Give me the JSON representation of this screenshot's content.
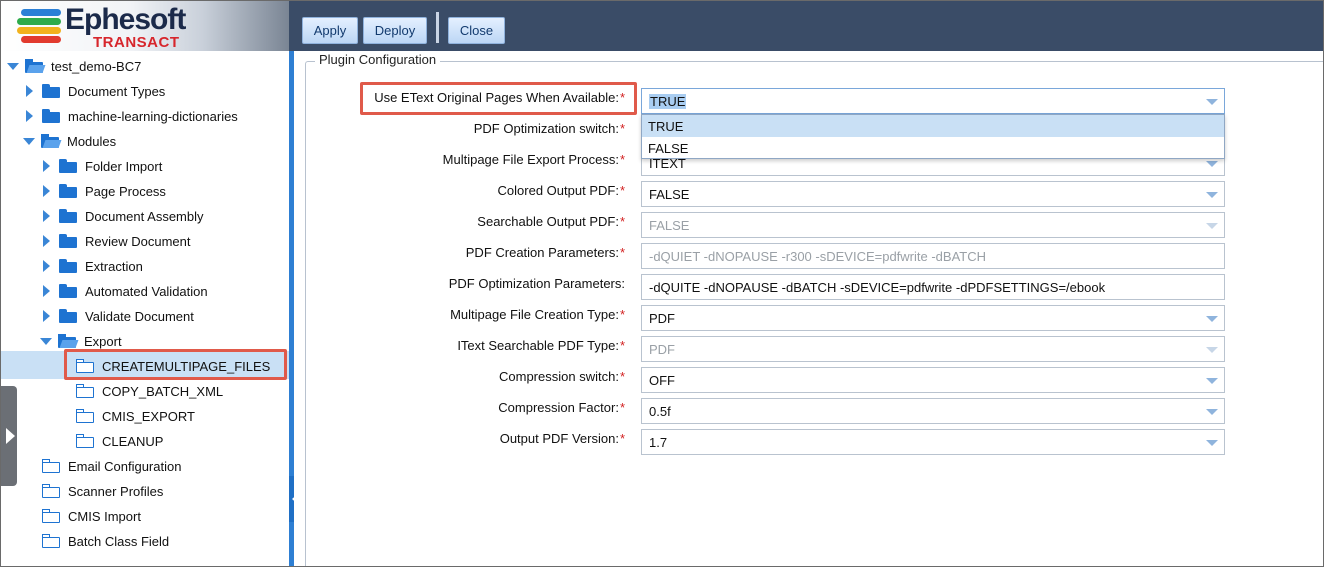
{
  "brand": {
    "name": "Ephesoft",
    "sub": "TRANSACT",
    "stripe_colors": [
      "#2a7fd6",
      "#2eab4b",
      "#f2b21d",
      "#e23b2f"
    ]
  },
  "toolbar": {
    "apply": "Apply",
    "deploy": "Deploy",
    "close": "Close"
  },
  "tree": {
    "root": "test_demo-BC7",
    "items": [
      "Document Types",
      "machine-learning-dictionaries",
      "Modules",
      "Folder Import",
      "Page Process",
      "Document Assembly",
      "Review Document",
      "Extraction",
      "Automated Validation",
      "Validate Document",
      "Export",
      "CREATEMULTIPAGE_FILES",
      "COPY_BATCH_XML",
      "CMIS_EXPORT",
      "CLEANUP",
      "Email Configuration",
      "Scanner Profiles",
      "CMIS Import",
      "Batch Class Field"
    ]
  },
  "config": {
    "legend": "Plugin Configuration",
    "required_mark": "*",
    "fields": [
      {
        "label": "Use EText Original Pages When Available:",
        "value": "TRUE",
        "required": true
      },
      {
        "label": "PDF Optimization switch:",
        "value": "",
        "required": true
      },
      {
        "label": "Multipage File Export Process:",
        "value": "ITEXT",
        "required": true
      },
      {
        "label": "Colored Output PDF:",
        "value": "FALSE",
        "required": true
      },
      {
        "label": "Searchable Output PDF:",
        "value": "FALSE",
        "required": true
      },
      {
        "label": "PDF Creation Parameters:",
        "value": "-dQUIET -dNOPAUSE -r300 -sDEVICE=pdfwrite -dBATCH",
        "required": true
      },
      {
        "label": "PDF Optimization Parameters:",
        "value": "-dQUITE -dNOPAUSE -dBATCH -sDEVICE=pdfwrite -dPDFSETTINGS=/ebook",
        "required": false
      },
      {
        "label": "Multipage File Creation Type:",
        "value": "PDF",
        "required": true
      },
      {
        "label": "IText Searchable PDF Type:",
        "value": "PDF",
        "required": true
      },
      {
        "label": "Compression switch:",
        "value": "OFF",
        "required": true
      },
      {
        "label": "Compression Factor:",
        "value": "0.5f",
        "required": true
      },
      {
        "label": "Output PDF Version:",
        "value": "1.7",
        "required": true
      }
    ],
    "dropdown_options": [
      "TRUE",
      "FALSE"
    ]
  }
}
